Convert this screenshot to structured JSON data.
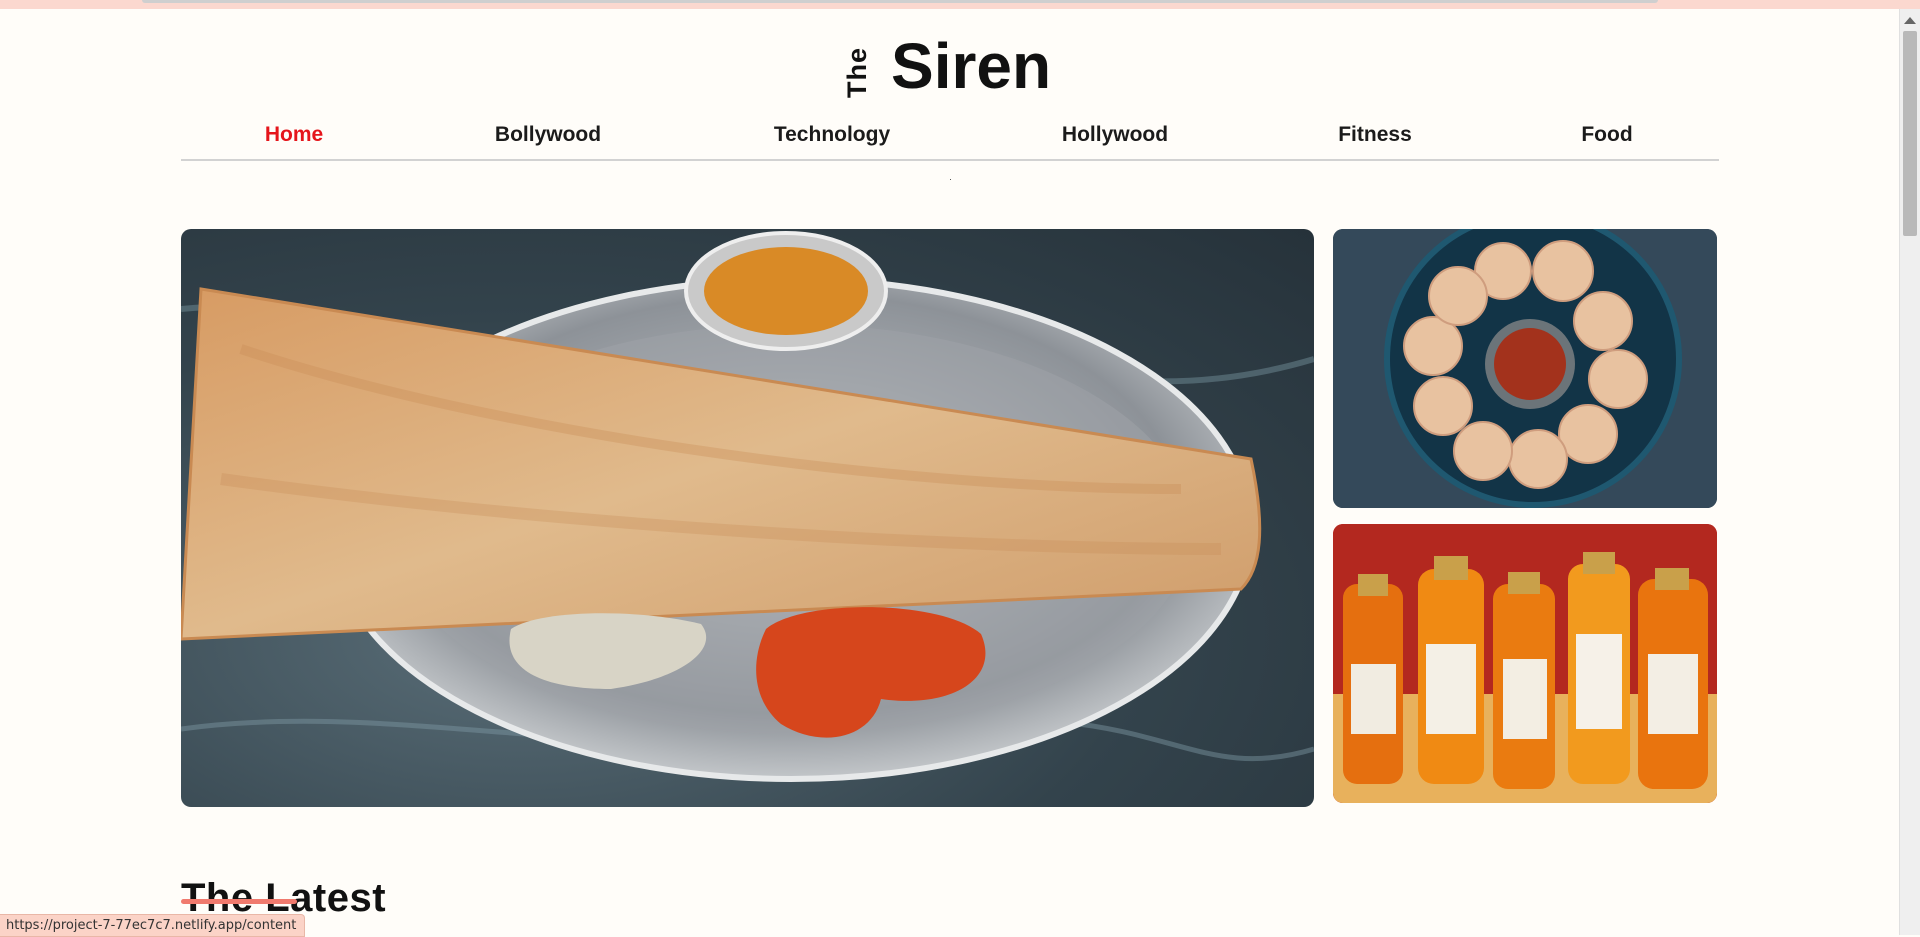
{
  "logo": {
    "the": "The",
    "siren": "Siren"
  },
  "nav": {
    "items": [
      {
        "label": "Home",
        "active": true
      },
      {
        "label": "Bollywood",
        "active": false
      },
      {
        "label": "Technology",
        "active": false
      },
      {
        "label": "Hollywood",
        "active": false
      },
      {
        "label": "Fitness",
        "active": false
      },
      {
        "label": "Food",
        "active": false
      }
    ]
  },
  "main": {
    "section_title": "The Latest"
  },
  "status_bar": {
    "url": "https://project-7-77ec7c7.netlify.app/content"
  },
  "colors": {
    "active_nav": "#e5151b",
    "underline": "#f07a6e",
    "background": "#fffdf9"
  }
}
